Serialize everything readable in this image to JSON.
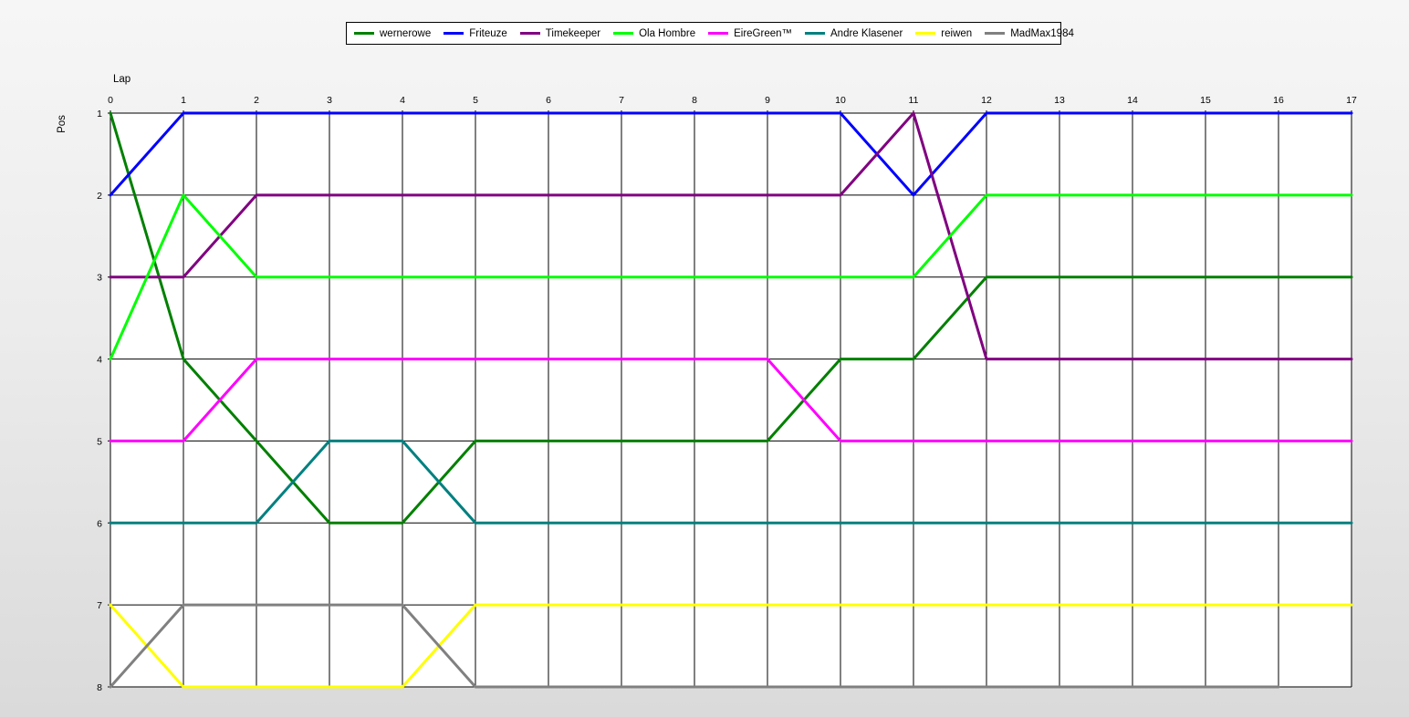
{
  "chart_data": {
    "type": "line",
    "xlabel": "Lap",
    "ylabel": "Pos",
    "xlim": [
      0,
      17
    ],
    "ylim": [
      1,
      8
    ],
    "y_inverted": true,
    "grid": true,
    "legend_position": "top-center",
    "x_ticks": [
      "0",
      "1",
      "2",
      "3",
      "4",
      "5",
      "6",
      "7",
      "8",
      "9",
      "10",
      "11",
      "12",
      "13",
      "14",
      "15",
      "16",
      "17"
    ],
    "y_ticks": [
      "1",
      "2",
      "3",
      "4",
      "5",
      "6",
      "7",
      "8"
    ],
    "series": [
      {
        "name": "wernerowe",
        "color": "#008000",
        "x": [
          0,
          1,
          2,
          3,
          4,
          5,
          6,
          7,
          8,
          9,
          10,
          11,
          12,
          13,
          14,
          15,
          16,
          17
        ],
        "y": [
          1,
          4,
          5,
          6,
          6,
          5,
          5,
          5,
          5,
          5,
          4,
          4,
          3,
          3,
          3,
          3,
          3,
          3
        ]
      },
      {
        "name": "Friteuze",
        "color": "#0000ff",
        "x": [
          0,
          1,
          2,
          3,
          4,
          5,
          6,
          7,
          8,
          9,
          10,
          11,
          12,
          13,
          14,
          15,
          16,
          17
        ],
        "y": [
          2,
          1,
          1,
          1,
          1,
          1,
          1,
          1,
          1,
          1,
          1,
          2,
          1,
          1,
          1,
          1,
          1,
          1
        ]
      },
      {
        "name": "Timekeeper",
        "color": "#800080",
        "x": [
          0,
          1,
          2,
          3,
          4,
          5,
          6,
          7,
          8,
          9,
          10,
          11,
          12,
          13,
          14,
          15,
          16,
          17
        ],
        "y": [
          3,
          3,
          2,
          2,
          2,
          2,
          2,
          2,
          2,
          2,
          2,
          1,
          4,
          4,
          4,
          4,
          4,
          4
        ]
      },
      {
        "name": "Ola Hombre",
        "color": "#00ff00",
        "x": [
          0,
          1,
          2,
          3,
          4,
          5,
          6,
          7,
          8,
          9,
          10,
          11,
          12,
          13,
          14,
          15,
          16,
          17
        ],
        "y": [
          4,
          2,
          3,
          3,
          3,
          3,
          3,
          3,
          3,
          3,
          3,
          3,
          2,
          2,
          2,
          2,
          2,
          2
        ]
      },
      {
        "name": "EireGreen™",
        "color": "#ff00ff",
        "x": [
          0,
          1,
          2,
          3,
          4,
          5,
          6,
          7,
          8,
          9,
          10,
          11,
          12,
          13,
          14,
          15,
          16,
          17
        ],
        "y": [
          5,
          5,
          4,
          4,
          4,
          4,
          4,
          4,
          4,
          4,
          5,
          5,
          5,
          5,
          5,
          5,
          5,
          5
        ]
      },
      {
        "name": "Andre Klasener",
        "color": "#008080",
        "x": [
          0,
          1,
          2,
          3,
          4,
          5,
          6,
          7,
          8,
          9,
          10,
          11,
          12,
          13,
          14,
          15,
          16,
          17
        ],
        "y": [
          6,
          6,
          6,
          5,
          5,
          6,
          6,
          6,
          6,
          6,
          6,
          6,
          6,
          6,
          6,
          6,
          6,
          6
        ]
      },
      {
        "name": "reiwen",
        "color": "#ffff00",
        "x": [
          0,
          1,
          2,
          3,
          4,
          5,
          6,
          7,
          8,
          9,
          10,
          11,
          12,
          13,
          14,
          15,
          16,
          17
        ],
        "y": [
          7,
          8,
          8,
          8,
          8,
          7,
          7,
          7,
          7,
          7,
          7,
          7,
          7,
          7,
          7,
          7,
          7,
          7
        ]
      },
      {
        "name": "MadMax1984",
        "color": "#808080",
        "x": [
          0,
          1,
          2,
          3,
          4,
          5,
          6,
          7,
          8,
          9,
          10,
          11,
          12,
          13,
          14,
          15,
          16
        ],
        "y": [
          8,
          7,
          7,
          7,
          7,
          8,
          8,
          8,
          8,
          8,
          8,
          8,
          8,
          8,
          8,
          8,
          8
        ]
      }
    ]
  }
}
